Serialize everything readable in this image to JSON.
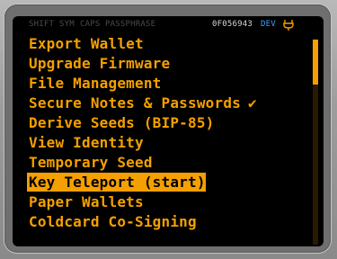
{
  "status": {
    "shift": "SHIFT",
    "sym": "SYM",
    "caps": "CAPS",
    "passphrase": "PASSPHRASE",
    "fingerprint": "0F056943",
    "mode": "DEV",
    "usb_icon": "usb-icon"
  },
  "menu": {
    "items": [
      {
        "label": "Export Wallet"
      },
      {
        "label": "Upgrade Firmware"
      },
      {
        "label": "File Management"
      },
      {
        "label": "Secure Notes & Passwords",
        "checked_mark": "✔"
      },
      {
        "label": "Derive Seeds (BIP-85)"
      },
      {
        "label": "View Identity"
      },
      {
        "label": "Temporary Seed"
      },
      {
        "label": "Key Teleport (start)",
        "selected": true
      },
      {
        "label": "Paper Wallets"
      },
      {
        "label": "Coldcard Co-Signing"
      }
    ]
  },
  "scrollbar": {
    "thumb_fraction": 0.22,
    "position_fraction": 0.0
  },
  "colors": {
    "accent": "#f5a000",
    "background": "#000000",
    "status_dim": "#4a4a4a",
    "dev": "#3aa3ff"
  }
}
